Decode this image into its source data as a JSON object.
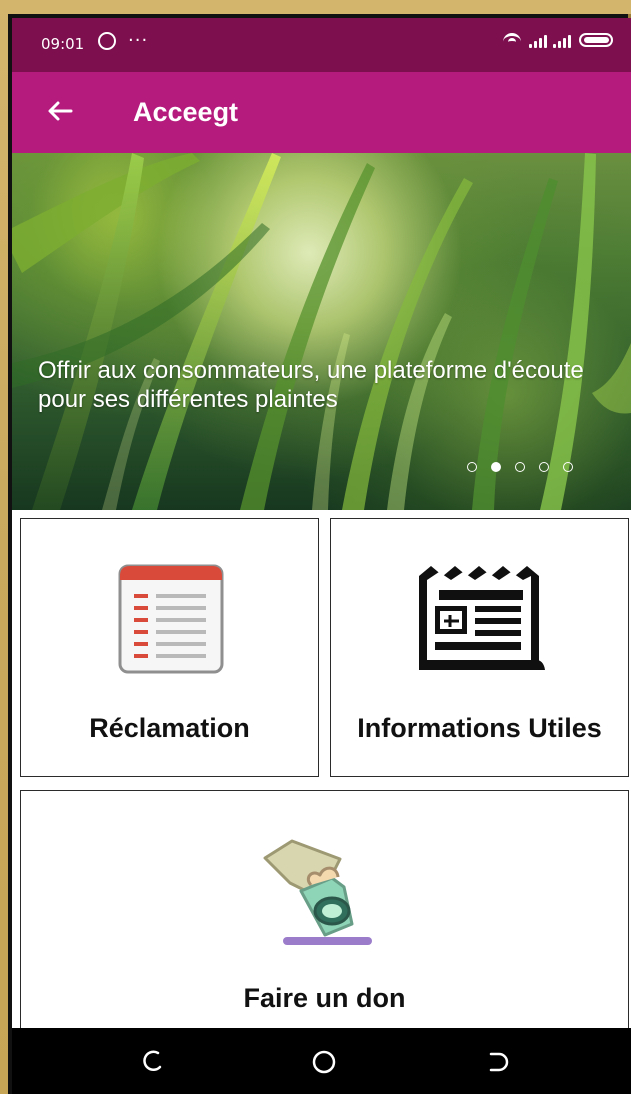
{
  "status_bar": {
    "time": "09:01",
    "more": "···"
  },
  "app_bar": {
    "title": "Acceegt"
  },
  "banner": {
    "text": "Offrir aux consommateurs, une plateforme d'écoute pour ses différentes plaintes",
    "dot_count": 5,
    "active_index": 1
  },
  "cards": {
    "reclamation_label": "Réclamation",
    "informations_label": "Informations Utiles",
    "don_label": "Faire un don"
  },
  "icons": {
    "back": "back-icon",
    "whatsapp": "whatsapp-icon",
    "wifi": "wifi-icon",
    "battery": "battery-icon",
    "reclamation": "document-icon",
    "informations": "newspaper-icon",
    "don": "donation-icon",
    "nav_recent": "recent-apps-icon",
    "nav_home": "home-icon",
    "nav_back": "nav-back-icon"
  },
  "colors": {
    "status_bar": "#7d0f4f",
    "app_bar": "#b51a7d",
    "outer_background": "#c9a95d",
    "card_border": "#2b2b2b"
  }
}
